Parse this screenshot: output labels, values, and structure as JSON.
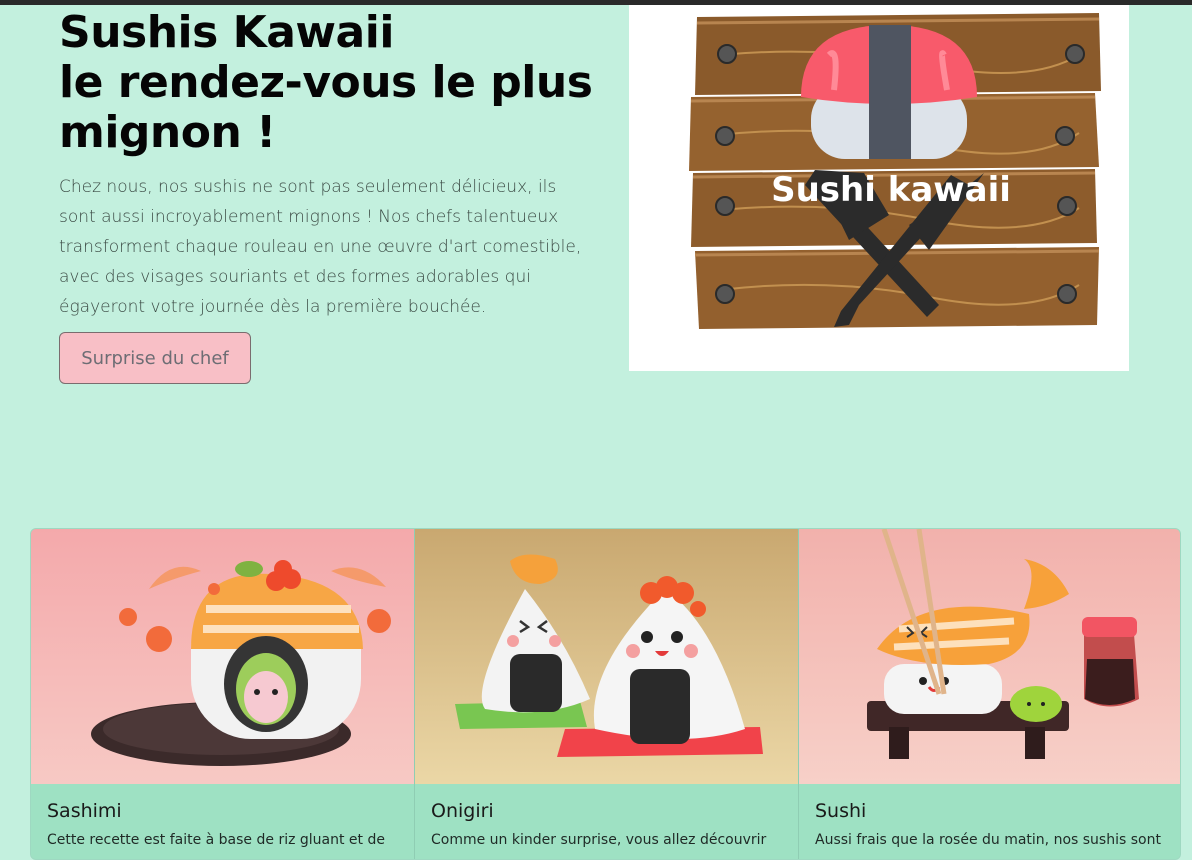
{
  "hero": {
    "title_line1": "Sushis Kawaii",
    "title_line2": "le rendez-vous le plus",
    "title_line3": "mignon !",
    "description": "Chez nous, nos sushis ne sont pas seulement délicieux, ils sont aussi incroyablement mignons ! Nos chefs talentueux transforment chaque rouleau en une œuvre d'art comestible, avec des visages souriants et des formes adorables qui égayeront votre journée dès la première bouchée.",
    "button_label": "Surprise du chef"
  },
  "logo": {
    "text": "Sushi kawaii"
  },
  "cards": [
    {
      "title": "Sashimi",
      "text": "Cette recette est faite à base de riz gluant et de"
    },
    {
      "title": "Onigiri",
      "text": "Comme un kinder surprise, vous allez découvrir"
    },
    {
      "title": "Sushi",
      "text": "Aussi frais que la rosée du matin, nos sushis sont"
    }
  ],
  "colors": {
    "background": "#c3f0de",
    "card_body": "#9ee1c3",
    "button": "#f8bfc6"
  }
}
